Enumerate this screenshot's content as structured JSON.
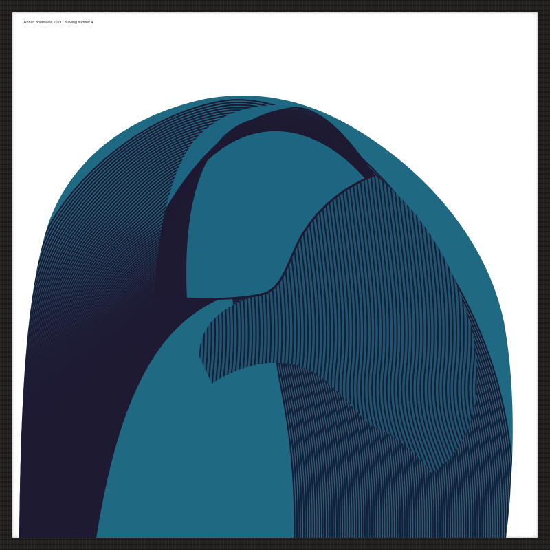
{
  "artwork": {
    "caption": "Ronan Bouroullec 2019 / drawing number 4",
    "colors": {
      "frame": "#23201f",
      "paper": "#ffffff",
      "ink_teal": "#1f6a82",
      "ink_light": "#3f8fa8",
      "ink_dark": "#1e1a33"
    }
  }
}
